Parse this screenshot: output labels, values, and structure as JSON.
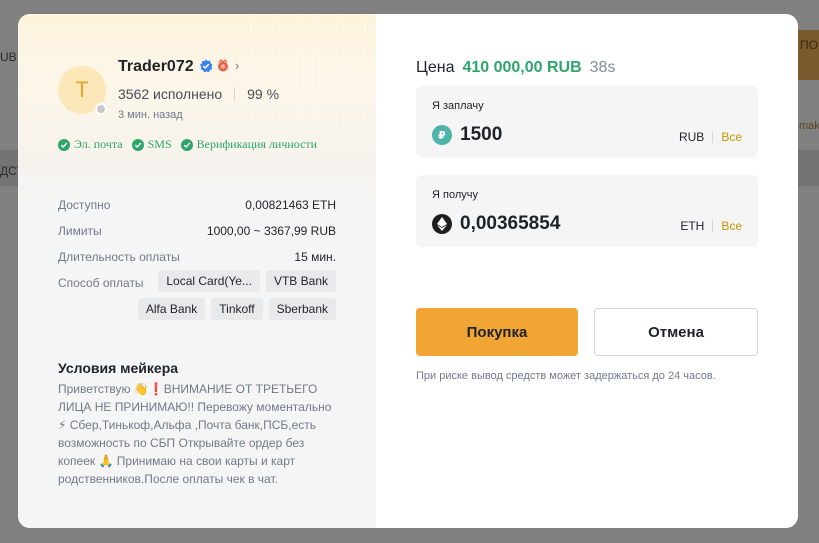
{
  "background": {
    "left_text": "UB",
    "left_text2": "ДСТ",
    "right_button_text": "ПОКУПКА",
    "right_text": "maker"
  },
  "trader": {
    "avatar_letter": "T",
    "name": "Trader072",
    "orders_completed": "3562 исполнено",
    "completion_rate": "99 %",
    "last_seen": "3 мин. назад",
    "verifications": [
      "Эл. почта",
      "SMS",
      "Верификация личности"
    ]
  },
  "details": {
    "available_label": "Доступно",
    "available_value": "0,00821463 ETH",
    "limits_label": "Лимиты",
    "limits_value": "1000,00 ~ 3367,99 RUB",
    "duration_label": "Длительность оплаты",
    "duration_value": "15 мин.",
    "payment_label": "Способ оплаты",
    "payment_methods": [
      "Local Card(Ye...",
      "VTB Bank",
      "Alfa Bank",
      "Tinkoff",
      "Sberbank"
    ]
  },
  "terms": {
    "title": "Условия мейкера",
    "text": "Приветствую 👋❗ВНИМАНИЕ ОТ ТРЕТЬЕГО ЛИЦА НЕ ПРИНИМАЮ!! Перевожу моментально ⚡ Сбер,Тинькоф,Альфа ,Почта банк,ПСБ,есть возможность по СБП Открывайте ордер без копеек 🙏 Принимаю на свои карты и карт родственников.После оплаты чек в чат."
  },
  "order": {
    "price_label": "Цена",
    "price_value": "410 000,00 RUB",
    "timer": "38s",
    "pay_label": "Я заплачу",
    "pay_amount": "1500",
    "pay_currency": "RUB",
    "pay_all": "Все",
    "receive_label": "Я получу",
    "receive_amount": "0,00365854",
    "receive_currency": "ETH",
    "receive_all": "Все",
    "buy_button": "Покупка",
    "cancel_button": "Отмена",
    "risk_note": "При риске вывод средств может задержаться до 24 часов."
  },
  "colors": {
    "accent": "#f0a534",
    "price_green": "#2ea56a",
    "all_link": "#c99400"
  }
}
